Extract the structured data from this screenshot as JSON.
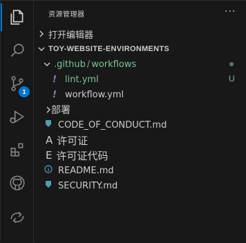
{
  "sidebar": {
    "title": "资源管理器",
    "more": "···",
    "open_editors": "打开编辑器",
    "workspace": "TOY-WEBSITE-ENVIRONMENTS",
    "folder_github": ".github",
    "folder_sep": "/",
    "folder_workflows": "workflows",
    "file_lint": "lint.yml",
    "file_lint_status": "U",
    "file_workflow": "workflow.yml",
    "folder_deploy": "部署",
    "file_coc": "CODE_OF_CONDUCT.md",
    "license_letter": "A",
    "license_label": "许可证",
    "license_code_letter": "E",
    "license_code_label": "许可证代码",
    "file_readme": "README.md",
    "file_security": "SECURITY.md"
  },
  "activity_bar": {
    "items": [
      "explorer-icon",
      "search-icon",
      "source-control-icon",
      "run-debug-icon",
      "extensions-icon",
      "github-icon",
      "remote-icon"
    ],
    "source_control_badge": "1"
  },
  "colors": {
    "accent": "#0078d4",
    "untracked_green": "#73c991",
    "yaml_purple": "#a074c4",
    "md_blue": "#519aba"
  }
}
